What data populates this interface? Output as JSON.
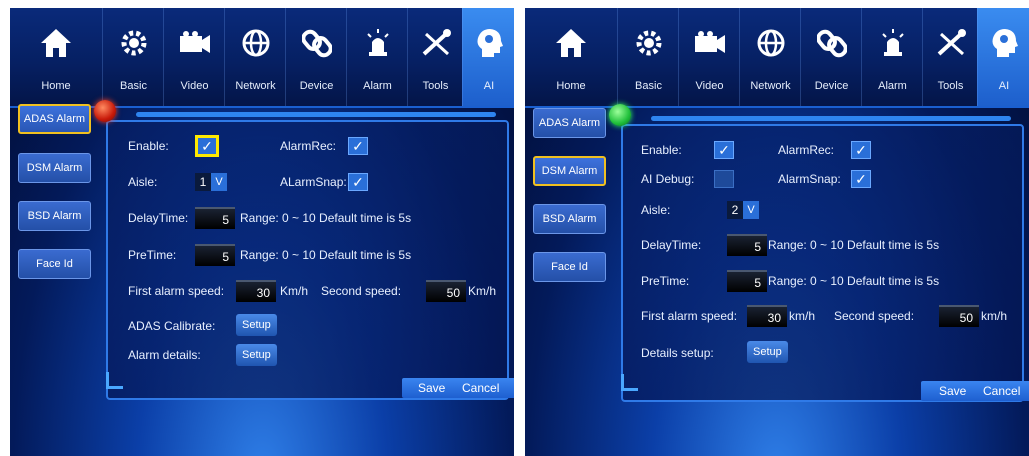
{
  "tabs": [
    {
      "label": "Home",
      "icon": "home-icon"
    },
    {
      "label": "Basic",
      "icon": "gear-icon"
    },
    {
      "label": "Video",
      "icon": "camera-icon"
    },
    {
      "label": "Network",
      "icon": "globe-icon"
    },
    {
      "label": "Device",
      "icon": "chain-link-icon"
    },
    {
      "label": "Alarm",
      "icon": "siren-icon"
    },
    {
      "label": "Tools",
      "icon": "wrench-screwdriver-icon"
    },
    {
      "label": "AI",
      "icon": "ai-head-icon"
    }
  ],
  "left": {
    "side_items": [
      "ADAS Alarm",
      "DSM Alarm",
      "BSD Alarm",
      "Face Id"
    ],
    "selected_side": "ADAS Alarm",
    "enable_label": "Enable:",
    "alarmrec_label": "AlarmRec:",
    "aisle_label": "Aisle:",
    "aisle_value": "1",
    "alarmsnap_label": "ALarmSnap:",
    "delaytime_label": "DelayTime:",
    "delaytime_value": "5",
    "delay_range": "Range: 0 ~ 10 Default time is 5s",
    "pretime_label": "PreTime:",
    "pretime_value": "5",
    "pre_range": "Range: 0 ~ 10 Default time is 5s",
    "first_speed_label": "First alarm speed:",
    "first_speed_value": "30",
    "first_unit": "Km/h",
    "second_speed_label": "Second speed:",
    "second_speed_value": "50",
    "second_unit": "Km/h",
    "calibrate_label": "ADAS Calibrate:",
    "details_label": "Alarm details:",
    "setup_label": "Setup",
    "save": "Save",
    "cancel": "Cancel",
    "indicator_color": "#d02010"
  },
  "right": {
    "selected_side": "DSM Alarm",
    "enable_label": "Enable:",
    "alarmrec_label": "AlarmRec:",
    "aidebug_label": "AI Debug:",
    "alarmsnap_label": "AlarmSnap:",
    "aisle_label": "Aisle:",
    "aisle_value": "2",
    "delaytime_label": "DelayTime:",
    "delaytime_value": "5",
    "delay_range": "Range: 0 ~ 10 Default time is 5s",
    "pretime_label": "PreTime:",
    "pretime_value": "5",
    "pre_range": "Range: 0 ~ 10 Default time is 5s",
    "first_speed_label": "First alarm speed:",
    "first_speed_value": "30",
    "first_unit": "km/h",
    "second_speed_label": "Second speed:",
    "second_speed_value": "50",
    "second_unit": "km/h",
    "details_label": "Details setup:",
    "setup_label": "Setup",
    "save": "Save",
    "cancel": "Cancel",
    "indicator_color": "#20c040"
  },
  "check_glyph": "✓",
  "dropdown_glyph": "V"
}
